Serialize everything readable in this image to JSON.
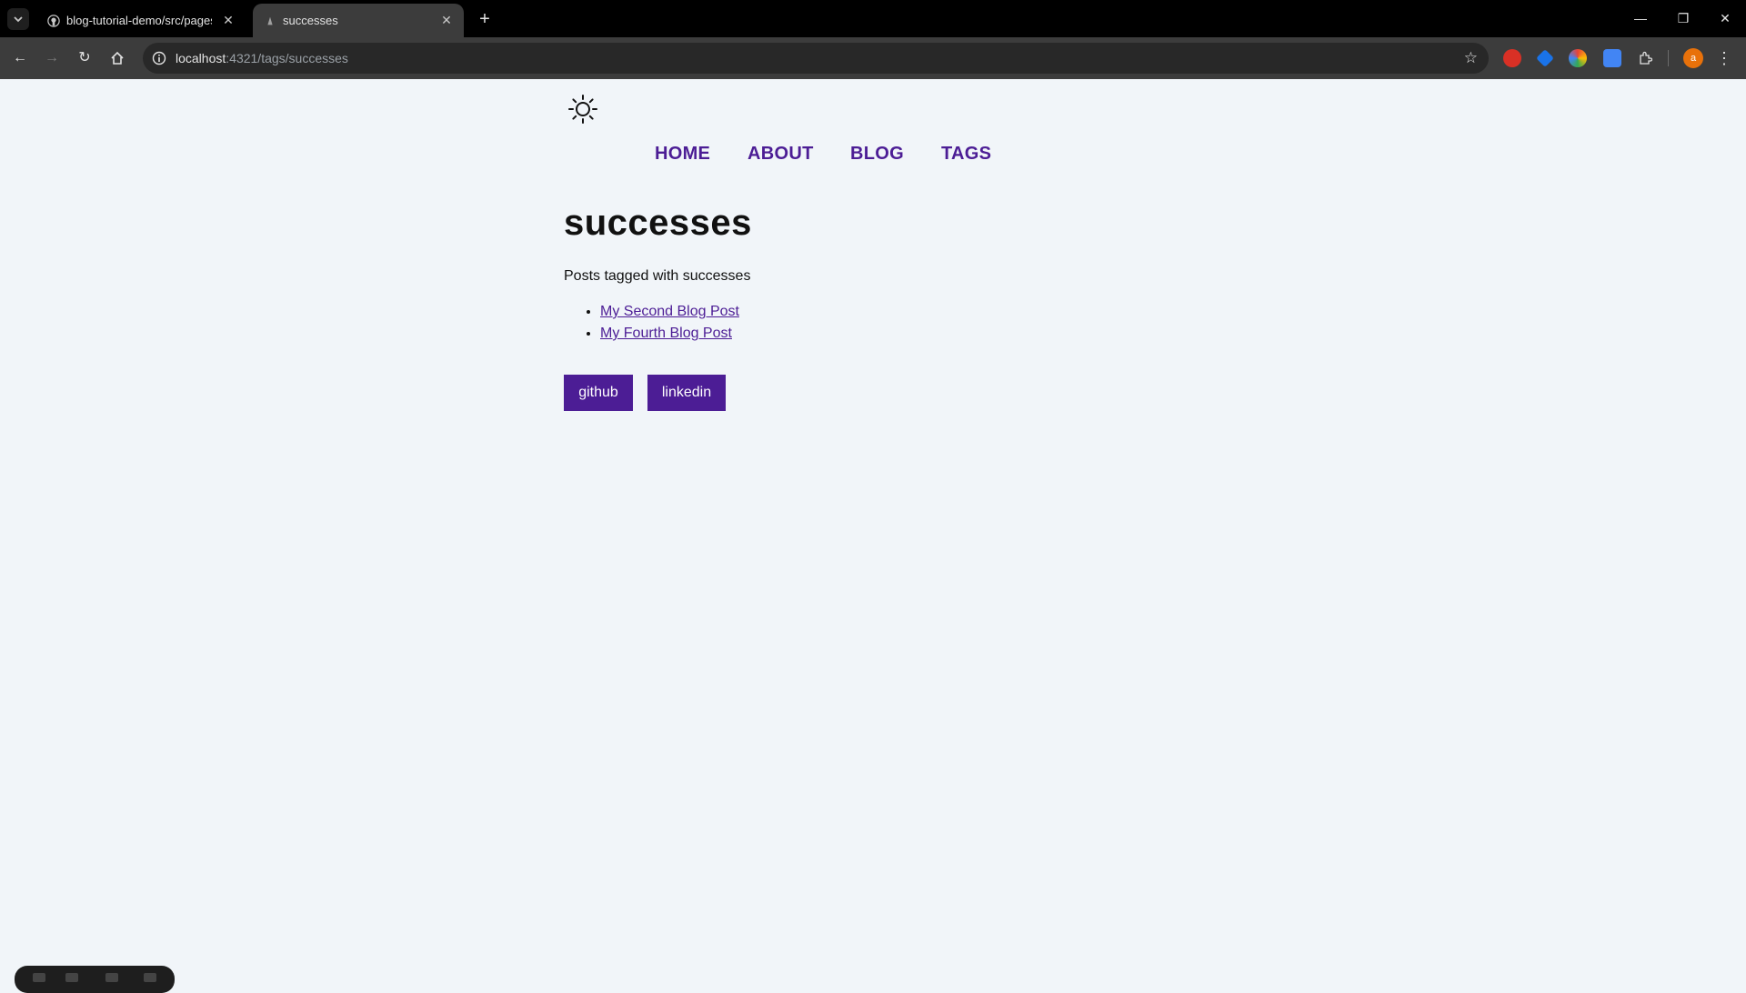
{
  "browser": {
    "tabs": [
      {
        "title": "blog-tutorial-demo/src/pages/",
        "icon": "github-icon",
        "active": false
      },
      {
        "title": "successes",
        "icon": "astro-icon",
        "active": true
      }
    ],
    "url_host": "localhost",
    "url_rest": ":4321/tags/successes",
    "profile_initial": "a",
    "accent": "#e8710a"
  },
  "site": {
    "nav": [
      {
        "label": "HOME"
      },
      {
        "label": "ABOUT"
      },
      {
        "label": "BLOG"
      },
      {
        "label": "TAGS"
      }
    ],
    "link_color": "#4c1d95",
    "background": "#f1f5f9"
  },
  "main": {
    "title": "successes",
    "intro": "Posts tagged with successes",
    "posts": [
      {
        "label": "My Second Blog Post"
      },
      {
        "label": "My Fourth Blog Post"
      }
    ]
  },
  "footer": {
    "social": [
      {
        "label": "github"
      },
      {
        "label": "linkedin"
      }
    ]
  }
}
